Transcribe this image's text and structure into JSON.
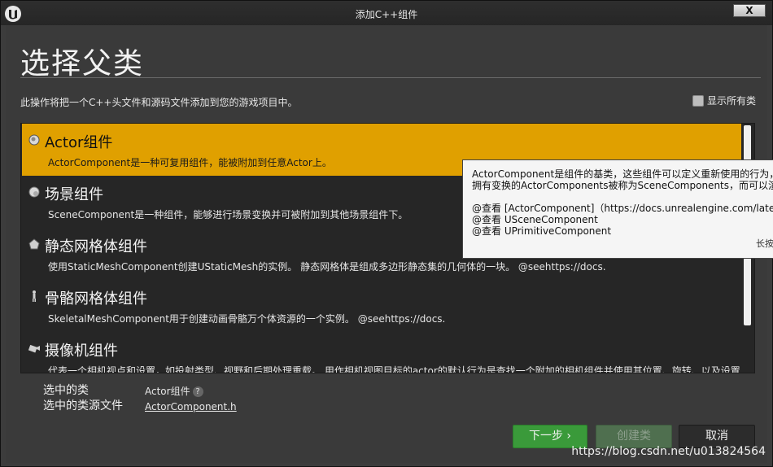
{
  "window": {
    "title": "添加C++组件",
    "close_label": "X"
  },
  "heading": "选择父类",
  "description": "此操作将把一个C++头文件和源码文件添加到您的游戏项目中。",
  "show_all_label": "显示所有类",
  "items": [
    {
      "icon": "actor-component-icon",
      "title": "Actor组件",
      "desc": "ActorComponent是一种可复用组件，能被附加到任意Actor上。",
      "selected": true
    },
    {
      "icon": "scene-component-icon",
      "title": "场景组件",
      "desc": "SceneComponent是一种组件，能够进行场景变换并可被附加到其他场景组件下。"
    },
    {
      "icon": "static-mesh-icon",
      "title": "静态网格体组件",
      "desc": "使用StaticMeshComponent创建UStaticMesh的实例。 静态网格体是组成多边形静态集的几何体的一块。 @seehttps://docs."
    },
    {
      "icon": "skeletal-mesh-icon",
      "title": "骨骼网格体组件",
      "desc": "SkeletalMeshComponent用于创建动画骨骼万个体资源的一个实例。 @seehttps://docs."
    },
    {
      "icon": "camera-icon",
      "title": "摄像机组件",
      "desc": "代表一个相机视点和设置，如投射类型、视野和后期处理重载。 用作相机视图目标的actor的默认行为是查找一个附加的相机组件并使用其位置、旋转、以及设置"
    }
  ],
  "tooltip": {
    "lines": [
      "ActorComponent是组件的基类，这些组件可以定义重新使用的行为，i",
      "拥有变换的ActorComponents被称为SceneComponents，而可以渲染的",
      "",
      "@查看 [ActorComponent]（https://docs.unrealengine.com/latest/INT",
      "@查看 USceneComponent",
      "@查看 UPrimitiveComponent"
    ],
    "more": "长按"
  },
  "selection": {
    "class_label": "选中的类",
    "source_label": "选中的类源文件",
    "class_value": "Actor组件",
    "source_value": "ActorComponent.h"
  },
  "buttons": {
    "next": "下一步 ›",
    "create": "创建类",
    "cancel": "取消"
  },
  "watermark": "https://blog.csdn.net/u013824564",
  "colors": {
    "selected": "#e0a000",
    "next": "#3a9a3a"
  }
}
